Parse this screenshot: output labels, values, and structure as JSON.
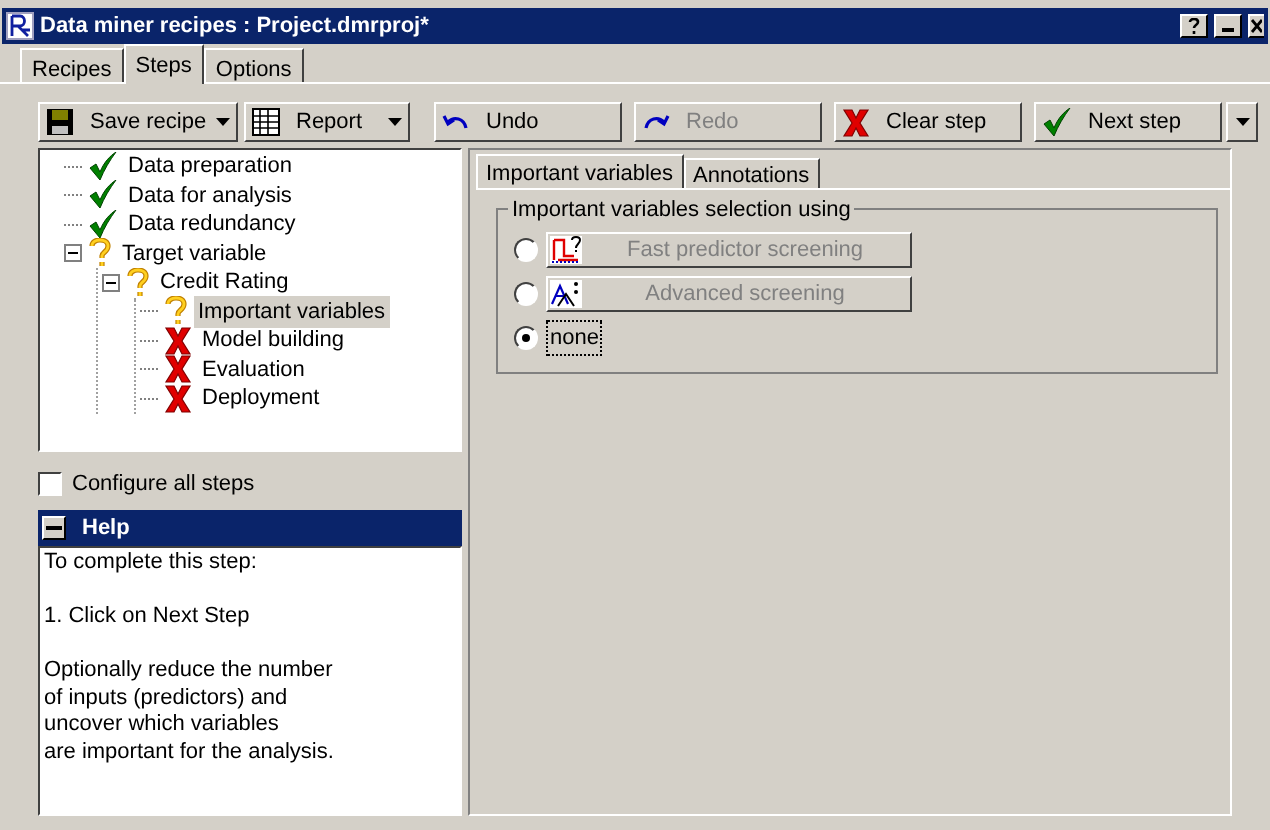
{
  "window": {
    "title": "Data miner recipes : Project.dmrproj*"
  },
  "tabs": [
    {
      "label": "Recipes",
      "selected": false
    },
    {
      "label": "Steps",
      "selected": true
    },
    {
      "label": "Options",
      "selected": false
    }
  ],
  "toolbar": [
    {
      "kind": "save",
      "label": "Save recipe",
      "dropdown": true,
      "disabled": false
    },
    {
      "kind": "report",
      "label": "Report",
      "dropdown": true,
      "disabled": false
    },
    {
      "kind": "undo",
      "label": "Undo",
      "dropdown": false,
      "disabled": false
    },
    {
      "kind": "redo",
      "label": "Redo",
      "dropdown": false,
      "disabled": true
    },
    {
      "kind": "clear",
      "label": "Clear step",
      "dropdown": false,
      "disabled": false
    },
    {
      "kind": "next",
      "label": "Next step",
      "dropdown": true,
      "disabled": false
    }
  ],
  "tree": [
    {
      "label": "Data preparation",
      "kind": "done",
      "selected": false
    },
    {
      "label": "Data for analysis",
      "kind": "done",
      "selected": false
    },
    {
      "label": "Data redundancy",
      "kind": "done",
      "selected": false
    },
    {
      "label": "Target variable",
      "kind": "pending",
      "selected": false,
      "expanded": true,
      "children": [
        {
          "label": "Credit Rating",
          "kind": "pending",
          "selected": false,
          "expanded": true,
          "children": [
            {
              "label": "Important variables",
              "kind": "pending",
              "selected": true
            },
            {
              "label": "Model building",
              "kind": "todo",
              "selected": false
            },
            {
              "label": "Evaluation",
              "kind": "todo",
              "selected": false
            },
            {
              "label": "Deployment",
              "kind": "todo",
              "selected": false
            }
          ]
        }
      ]
    }
  ],
  "configure_all_steps": {
    "label": "Configure all steps",
    "checked": false
  },
  "help": {
    "title": "Help",
    "paragraphs": [
      {
        "lines": [
          "To complete this step:"
        ]
      },
      {
        "lines": [
          "1. Click on Next Step"
        ]
      },
      {
        "lines": [
          "Optionally reduce the number",
          "of inputs (predictors) and",
          "uncover which variables",
          "are important for the analysis."
        ]
      }
    ]
  },
  "panel_tabs": [
    {
      "label": "Important variables",
      "selected": true
    },
    {
      "label": "Annotations",
      "selected": false
    }
  ],
  "group": {
    "title": "Important variables selection using",
    "options": [
      {
        "kind": "fast",
        "label": "Fast predictor screening",
        "selected": false,
        "disabled": true
      },
      {
        "kind": "advanced",
        "label": "Advanced screening",
        "selected": false,
        "disabled": true
      },
      {
        "kind": "plain",
        "label": "none",
        "selected": true,
        "disabled": false
      }
    ]
  }
}
